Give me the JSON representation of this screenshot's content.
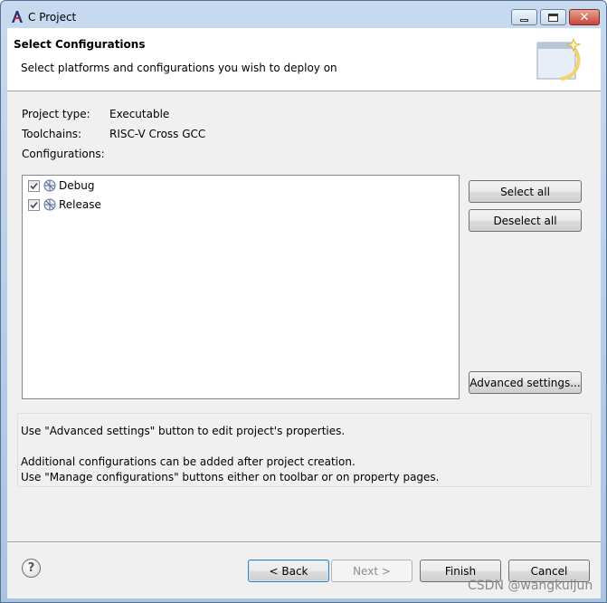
{
  "window": {
    "title": "C Project",
    "app_icon": "eclipse-cdt-icon",
    "minimize_icon": "minimize-icon",
    "maximize_icon": "maximize-icon",
    "close_icon": "close-icon",
    "close_glyph": "✕"
  },
  "banner": {
    "title": "Select Configurations",
    "description": "Select platforms and configurations you wish to deploy on",
    "image_icon": "wizard-banner-icon"
  },
  "project_info": {
    "project_type_label": "Project type:",
    "project_type_value": "Executable",
    "toolchains_label": "Toolchains:",
    "toolchains_value": "RISC-V Cross GCC",
    "configurations_label": "Configurations:"
  },
  "configurations": [
    {
      "label": "Debug",
      "checked": true,
      "icon": "build-config-icon"
    },
    {
      "label": "Release",
      "checked": true,
      "icon": "build-config-icon"
    }
  ],
  "side_buttons": {
    "select_all": "Select all",
    "deselect_all": "Deselect all",
    "advanced_settings": "Advanced settings..."
  },
  "messages": {
    "line1": "Use \"Advanced settings\" button to edit project's properties.",
    "line2": "Additional configurations can be added after project creation.",
    "line3": "Use \"Manage configurations\" buttons either on toolbar or on property pages."
  },
  "footer": {
    "help_icon": "help-icon",
    "help_glyph": "?",
    "back": "< Back",
    "next": "Next >",
    "finish": "Finish",
    "cancel": "Cancel"
  },
  "watermark": "CSDN @wangkuijun",
  "colors": {
    "title_bar": "#b9d1ea",
    "dialog_bg": "#f0f0f0",
    "default_button_border": "#3c7fb1"
  }
}
